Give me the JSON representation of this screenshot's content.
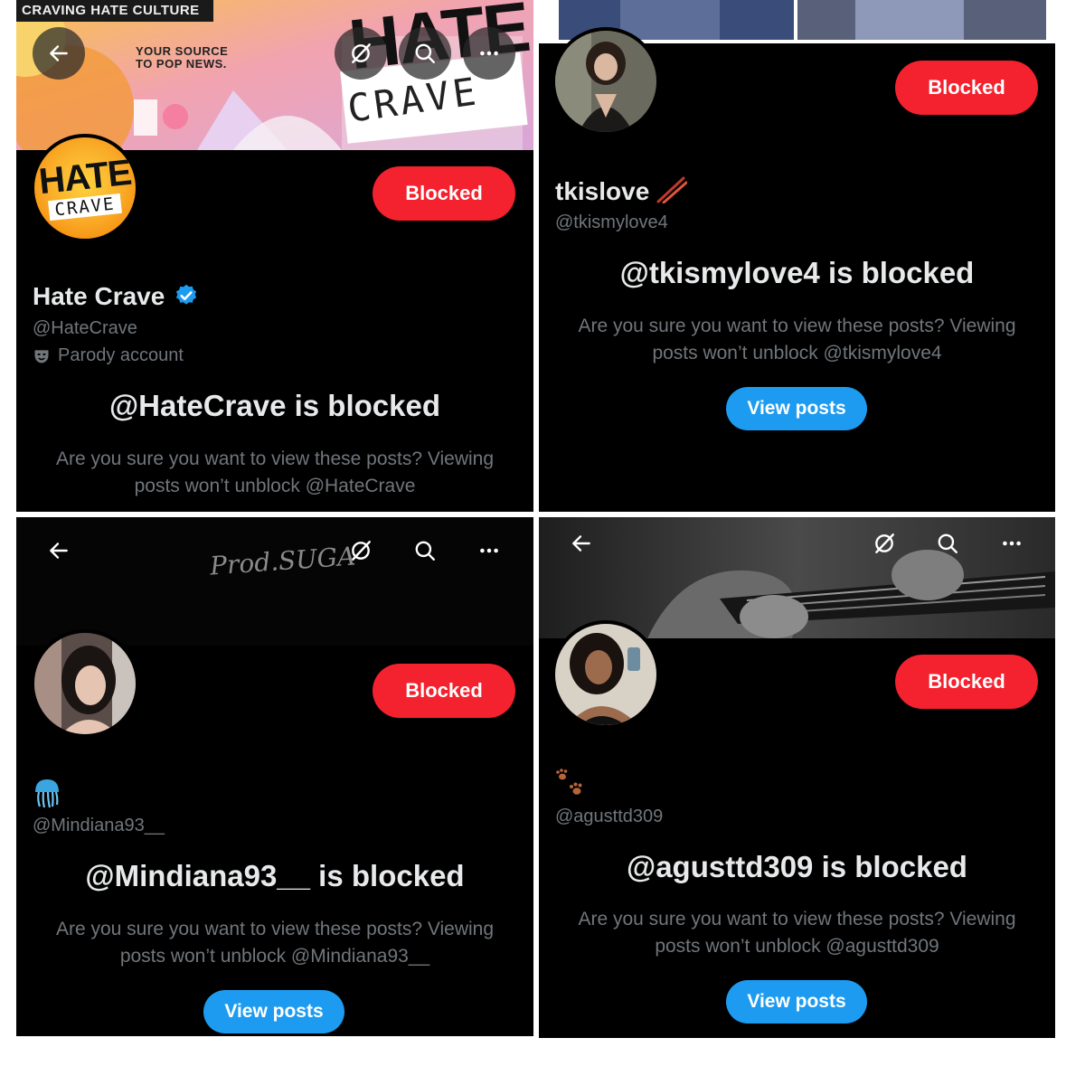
{
  "panels": [
    {
      "banner": {
        "top_text": "CRAVING HATE CULTURE",
        "tagline_line1": "YOUR SOURCE",
        "tagline_line2": "TO POP NEWS.",
        "logo_word1": "HATE",
        "logo_word2": "CRAVE"
      },
      "avatar": {
        "word1": "HATE",
        "word2": "CRAVE"
      },
      "blocked_label": "Blocked",
      "display_name": "Hate Crave",
      "verified": true,
      "handle": "@HateCrave",
      "account_label": "Parody account",
      "blocked_title": "@HateCrave is blocked",
      "confirm_line1": "Are you sure you want to view these posts? Viewing",
      "confirm_line2": "posts won’t unblock @HateCrave"
    },
    {
      "blocked_label": "Blocked",
      "display_name": "tkislove",
      "name_emoji": "chopsticks",
      "handle": "@tkismylove4",
      "blocked_title": "@tkismylove4 is blocked",
      "confirm_line1": "Are you sure you want to view these posts? Viewing",
      "confirm_line2": "posts won’t unblock @tkismylove4",
      "view_posts_label": "View posts"
    },
    {
      "banner_text": "Prod.SUGA",
      "blocked_label": "Blocked",
      "name_emoji": "jellyfish",
      "handle": "@Mindiana93__",
      "blocked_title": "@Mindiana93__ is blocked",
      "confirm_line1": "Are you sure you want to view these posts? Viewing",
      "confirm_line2": "posts won’t unblock @Mindiana93__",
      "view_posts_label": "View posts"
    },
    {
      "blocked_label": "Blocked",
      "name_emoji": "paw-prints",
      "handle": "@agusttd309",
      "blocked_title": "@agusttd309 is blocked",
      "confirm_line1": "Are you sure you want to view these posts? Viewing",
      "confirm_line2": "posts won’t unblock @agusttd309",
      "view_posts_label": "View posts"
    }
  ],
  "colors": {
    "background": "#000000",
    "blocked_button": "#f4212e",
    "view_posts_button": "#1d9bf0",
    "verified_badge": "#1d9bf0",
    "primary_text": "#e7e9ea",
    "secondary_text": "#71767b"
  },
  "icons": [
    "back-arrow-icon",
    "grok-icon",
    "search-icon",
    "more-icon",
    "verified-badge-icon",
    "parody-mask-icon"
  ]
}
